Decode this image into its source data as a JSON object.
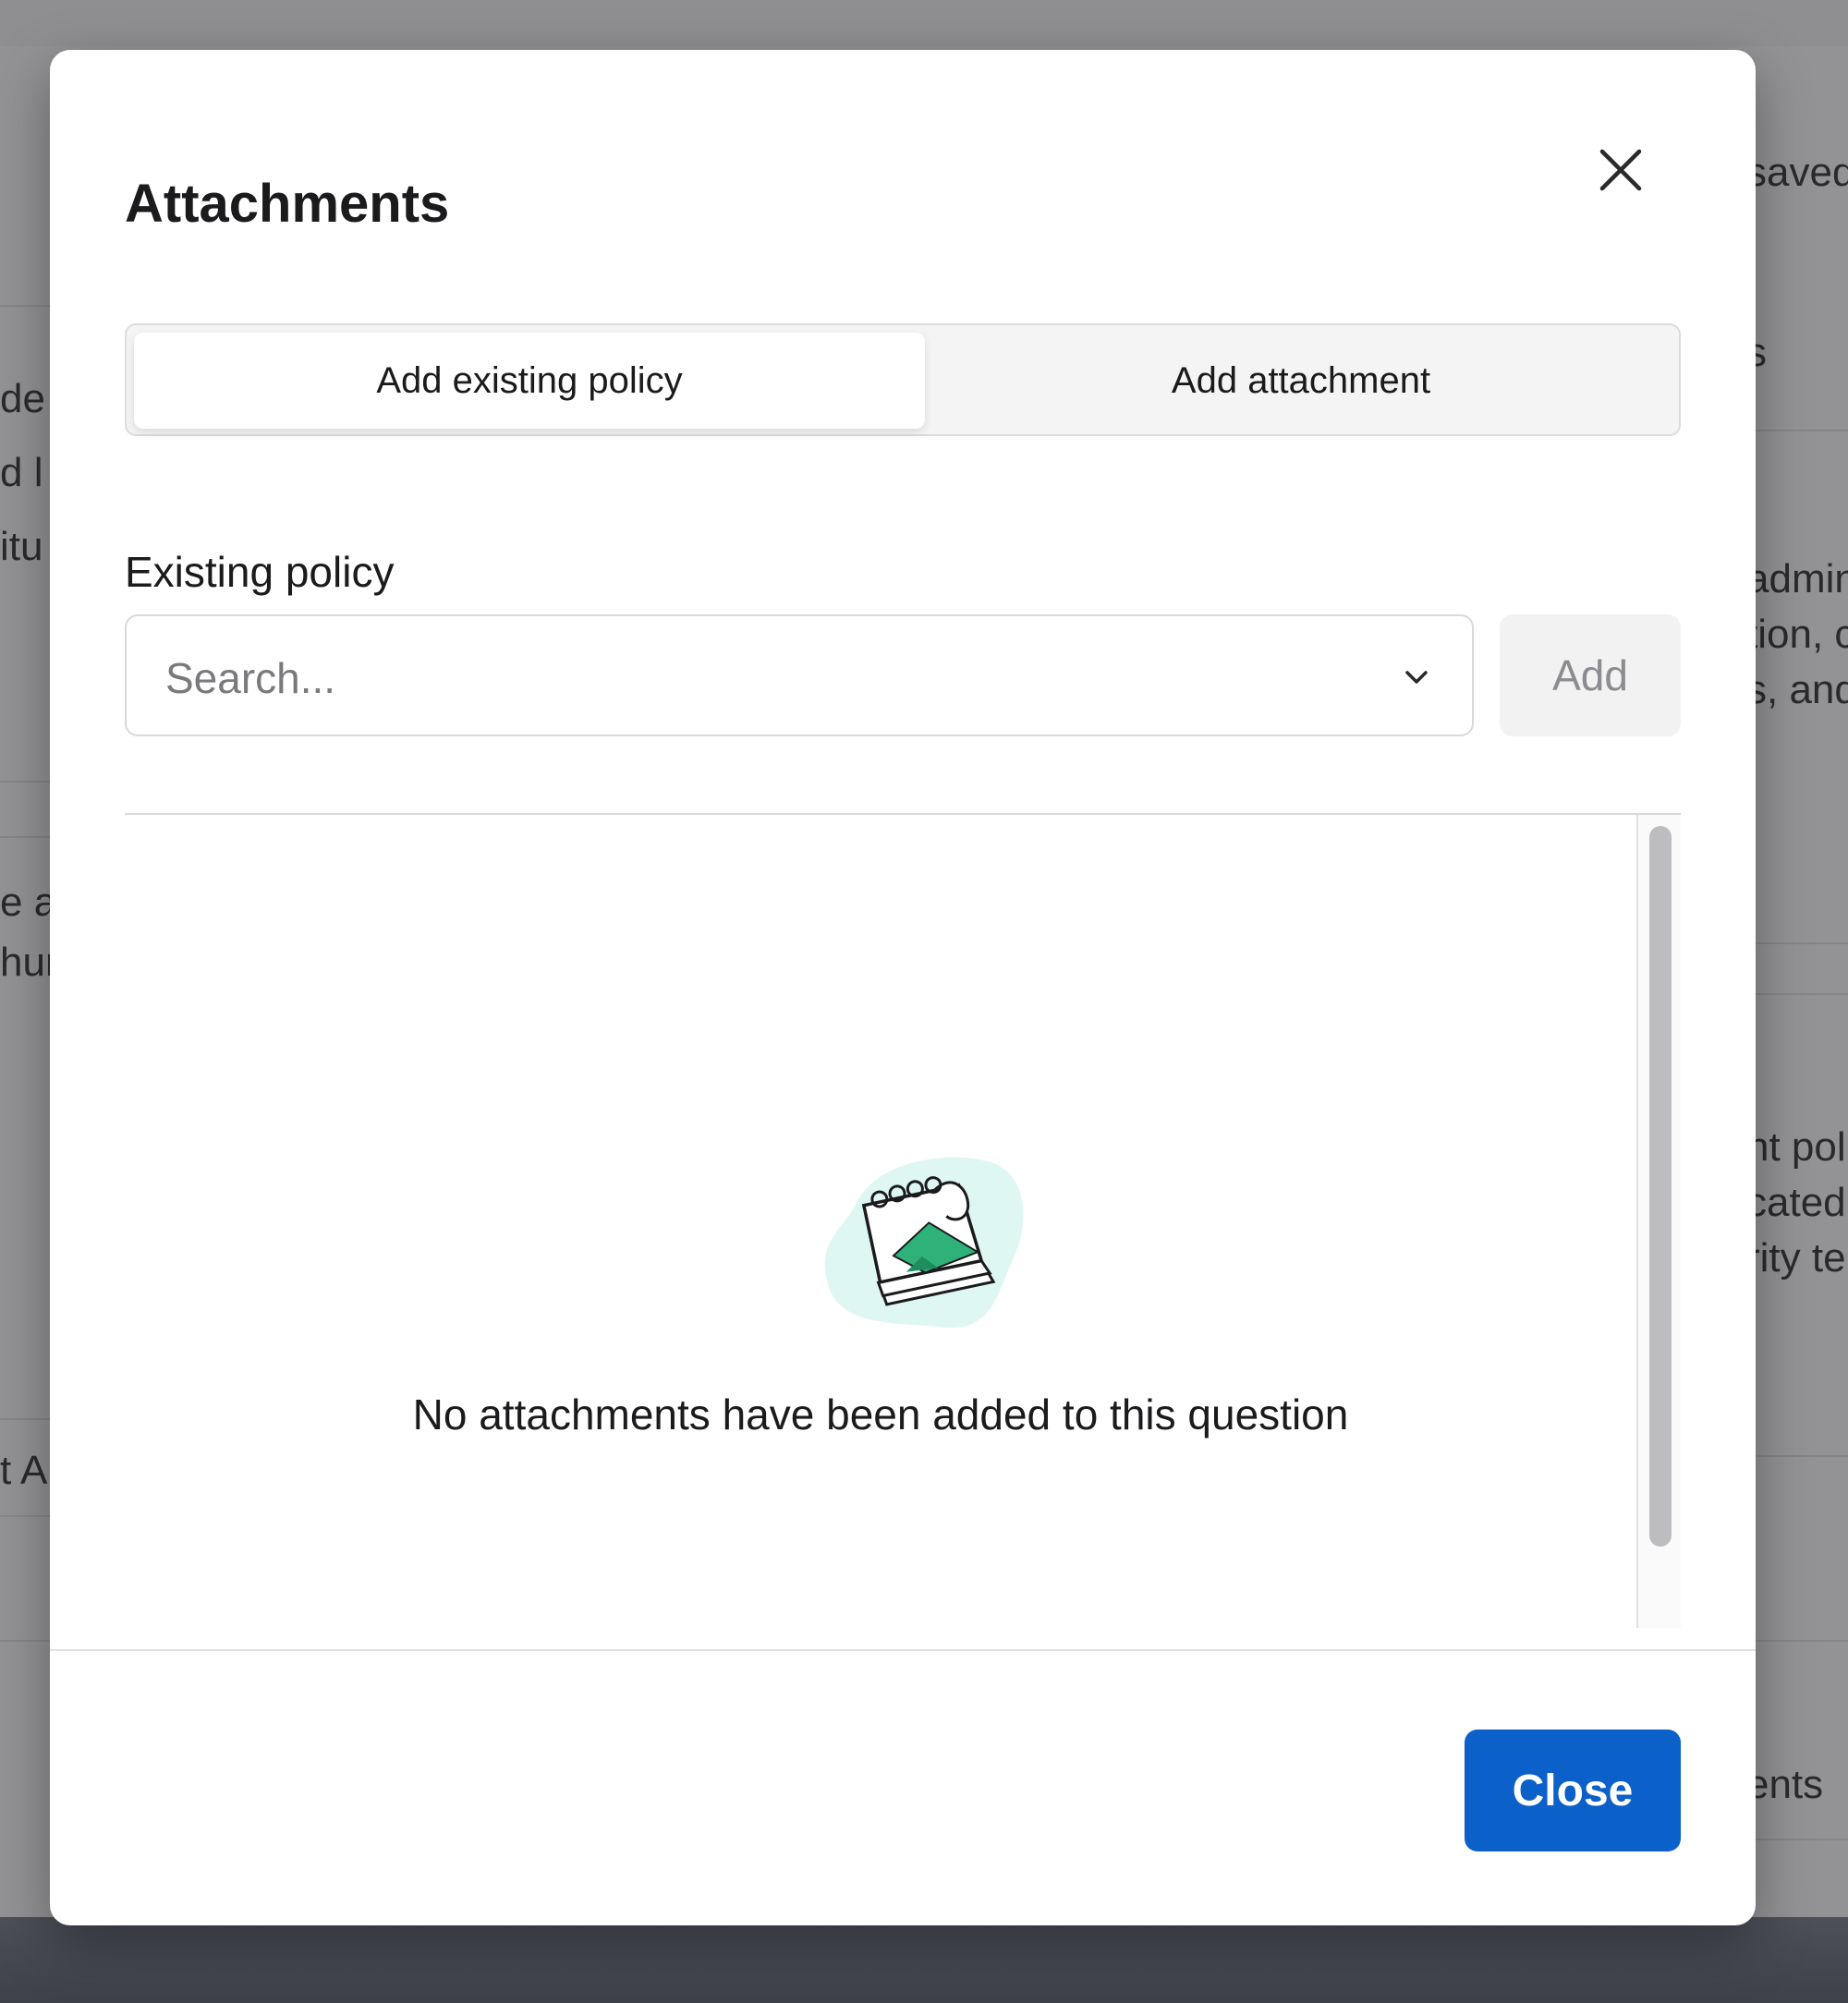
{
  "modal": {
    "title": "Attachments",
    "close_icon": "close-icon",
    "tabs": [
      {
        "label": "Add existing policy",
        "active": true
      },
      {
        "label": "Add attachment",
        "active": false
      }
    ],
    "field_label": "Existing policy",
    "search": {
      "placeholder": "Search...",
      "icon": "chevron-down-icon"
    },
    "add_button": "Add",
    "empty_state": {
      "icon": "notepad-illustration",
      "message": "No attachments have been added to this question"
    },
    "close_button": "Close"
  },
  "background": {
    "fragments": [
      "saved",
      "s",
      "de",
      "d l",
      "itu",
      "admin",
      "tion, c",
      "s, and",
      "e a",
      "hur",
      "nt pol",
      "cated",
      "rity te",
      "t A",
      "ents"
    ]
  },
  "colors": {
    "primary": "#0b60c9",
    "illustration_green": "#2fb27a",
    "illustration_bg": "#dff7f3"
  }
}
